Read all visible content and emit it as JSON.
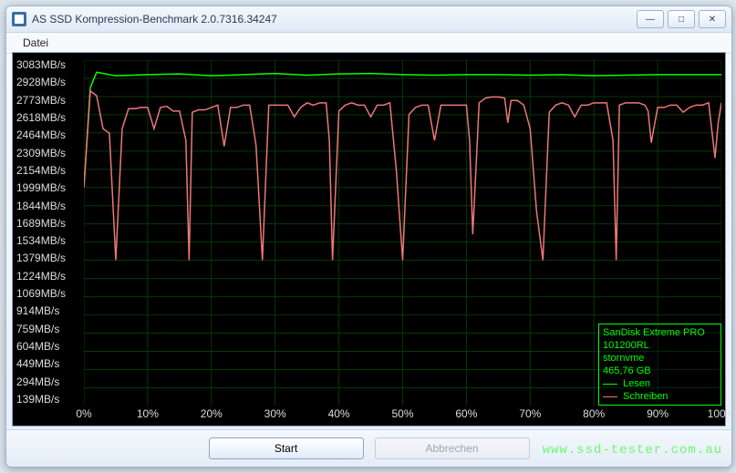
{
  "window": {
    "title": "AS SSD Kompression-Benchmark 2.0.7316.34247",
    "buttons": {
      "minimize": "—",
      "maximize": "□",
      "close": "✕"
    }
  },
  "menu": {
    "file": "Datei"
  },
  "buttons": {
    "start": "Start",
    "cancel": "Abbrechen"
  },
  "legend": {
    "device_line1": "SanDisk Extreme PRO",
    "device_line2": "101200RL",
    "driver": "stornvme",
    "capacity": "465,76 GB",
    "read_label": "Lesen",
    "write_label": "Schreiben"
  },
  "watermark": "www.ssd-tester.com.au",
  "chart_data": {
    "type": "line",
    "title": "",
    "xlabel": "",
    "ylabel": "",
    "x_unit": "%",
    "y_unit": "MB/s",
    "y_ticks": [
      3083,
      2928,
      2773,
      2618,
      2464,
      2309,
      2154,
      1999,
      1844,
      1689,
      1534,
      1379,
      1224,
      1069,
      914,
      759,
      604,
      449,
      294,
      139
    ],
    "x_ticks": [
      0,
      10,
      20,
      30,
      40,
      50,
      60,
      70,
      80,
      90,
      100
    ],
    "ylim": [
      139,
      3083
    ],
    "xlim": [
      0,
      100
    ],
    "series": [
      {
        "name": "Lesen",
        "color": "#00ff00",
        "data": [
          [
            0,
            2000
          ],
          [
            1,
            2850
          ],
          [
            2,
            2980
          ],
          [
            5,
            2950
          ],
          [
            10,
            2960
          ],
          [
            15,
            2965
          ],
          [
            20,
            2950
          ],
          [
            25,
            2960
          ],
          [
            30,
            2970
          ],
          [
            35,
            2955
          ],
          [
            40,
            2965
          ],
          [
            45,
            2970
          ],
          [
            50,
            2960
          ],
          [
            55,
            2955
          ],
          [
            60,
            2960
          ],
          [
            65,
            2960
          ],
          [
            70,
            2955
          ],
          [
            75,
            2960
          ],
          [
            80,
            2950
          ],
          [
            85,
            2955
          ],
          [
            90,
            2960
          ],
          [
            95,
            2960
          ],
          [
            100,
            2960
          ]
        ]
      },
      {
        "name": "Schreiben",
        "color": "#ee7777",
        "data": [
          [
            0,
            2000
          ],
          [
            1,
            2820
          ],
          [
            2,
            2780
          ],
          [
            3,
            2500
          ],
          [
            4,
            2460
          ],
          [
            5,
            1380
          ],
          [
            6,
            2500
          ],
          [
            7,
            2670
          ],
          [
            8,
            2670
          ],
          [
            9,
            2680
          ],
          [
            10,
            2680
          ],
          [
            11,
            2500
          ],
          [
            12,
            2680
          ],
          [
            13,
            2690
          ],
          [
            14,
            2650
          ],
          [
            15,
            2650
          ],
          [
            16,
            2400
          ],
          [
            16.5,
            1380
          ],
          [
            17,
            2640
          ],
          [
            18,
            2660
          ],
          [
            19,
            2660
          ],
          [
            20,
            2680
          ],
          [
            21,
            2700
          ],
          [
            22,
            2350
          ],
          [
            23,
            2680
          ],
          [
            24,
            2680
          ],
          [
            25,
            2700
          ],
          [
            26,
            2700
          ],
          [
            27,
            2360
          ],
          [
            28,
            1380
          ],
          [
            29,
            2700
          ],
          [
            30,
            2700
          ],
          [
            31,
            2700
          ],
          [
            32,
            2700
          ],
          [
            33,
            2600
          ],
          [
            34,
            2680
          ],
          [
            35,
            2720
          ],
          [
            36,
            2700
          ],
          [
            37,
            2720
          ],
          [
            38,
            2720
          ],
          [
            38.5,
            2400
          ],
          [
            39,
            1380
          ],
          [
            40,
            2650
          ],
          [
            41,
            2700
          ],
          [
            42,
            2720
          ],
          [
            43,
            2700
          ],
          [
            44,
            2700
          ],
          [
            45,
            2600
          ],
          [
            46,
            2700
          ],
          [
            47,
            2700
          ],
          [
            48,
            2720
          ],
          [
            49,
            2150
          ],
          [
            50,
            1380
          ],
          [
            51,
            2620
          ],
          [
            52,
            2680
          ],
          [
            53,
            2700
          ],
          [
            54,
            2700
          ],
          [
            55,
            2400
          ],
          [
            56,
            2700
          ],
          [
            57,
            2700
          ],
          [
            58,
            2700
          ],
          [
            59,
            2700
          ],
          [
            60,
            2700
          ],
          [
            60.5,
            2400
          ],
          [
            61,
            1600
          ],
          [
            62,
            2720
          ],
          [
            63,
            2760
          ],
          [
            64,
            2770
          ],
          [
            65,
            2770
          ],
          [
            66,
            2760
          ],
          [
            66.5,
            2550
          ],
          [
            67,
            2740
          ],
          [
            68,
            2740
          ],
          [
            69,
            2700
          ],
          [
            70,
            2500
          ],
          [
            71,
            1800
          ],
          [
            72,
            1380
          ],
          [
            73,
            2640
          ],
          [
            74,
            2700
          ],
          [
            75,
            2720
          ],
          [
            76,
            2700
          ],
          [
            77,
            2600
          ],
          [
            78,
            2700
          ],
          [
            79,
            2700
          ],
          [
            80,
            2720
          ],
          [
            81,
            2720
          ],
          [
            82,
            2720
          ],
          [
            83,
            2400
          ],
          [
            83.5,
            1380
          ],
          [
            84,
            2700
          ],
          [
            85,
            2720
          ],
          [
            86,
            2720
          ],
          [
            87,
            2720
          ],
          [
            88,
            2700
          ],
          [
            88.5,
            2650
          ],
          [
            89,
            2380
          ],
          [
            90,
            2680
          ],
          [
            91,
            2680
          ],
          [
            92,
            2700
          ],
          [
            93,
            2700
          ],
          [
            94,
            2640
          ],
          [
            95,
            2680
          ],
          [
            96,
            2700
          ],
          [
            97,
            2700
          ],
          [
            98,
            2720
          ],
          [
            99,
            2250
          ],
          [
            99.5,
            2550
          ],
          [
            100,
            2720
          ]
        ]
      }
    ]
  }
}
